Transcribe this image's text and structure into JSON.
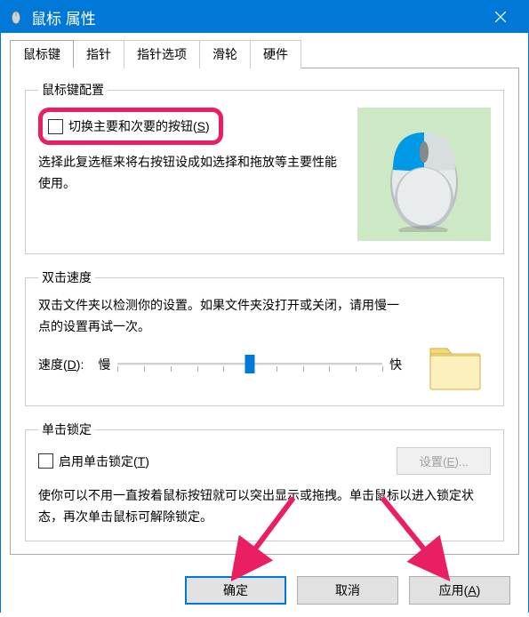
{
  "window": {
    "title": "鼠标 属性"
  },
  "tabs": [
    {
      "label": "鼠标键"
    },
    {
      "label": "指针"
    },
    {
      "label": "指针选项"
    },
    {
      "label": "滑轮"
    },
    {
      "label": "硬件"
    }
  ],
  "button_config": {
    "legend": "鼠标键配置",
    "swap_label": "切换主要和次要的按钮(S)",
    "description": "选择此复选框来将右按钮设成如选择和拖放等主要性能使用。"
  },
  "double_click": {
    "legend": "双击速度",
    "description": "双击文件夹以检测你的设置。如果文件夹没打开或关闭，请用慢一点的设置再试一次。",
    "speed_label": "速度(D):",
    "slow": "慢",
    "fast": "快"
  },
  "click_lock": {
    "legend": "单击锁定",
    "enable_label": "启用单击锁定(T)",
    "settings_label": "设置(E)...",
    "description": "使你可以不用一直按着鼠标按钮就可以突出显示或拖拽。单击鼠标以进入锁定状态，再次单击鼠标可解除锁定。"
  },
  "buttons": {
    "ok": "确定",
    "cancel": "取消",
    "apply": "应用(A)"
  }
}
